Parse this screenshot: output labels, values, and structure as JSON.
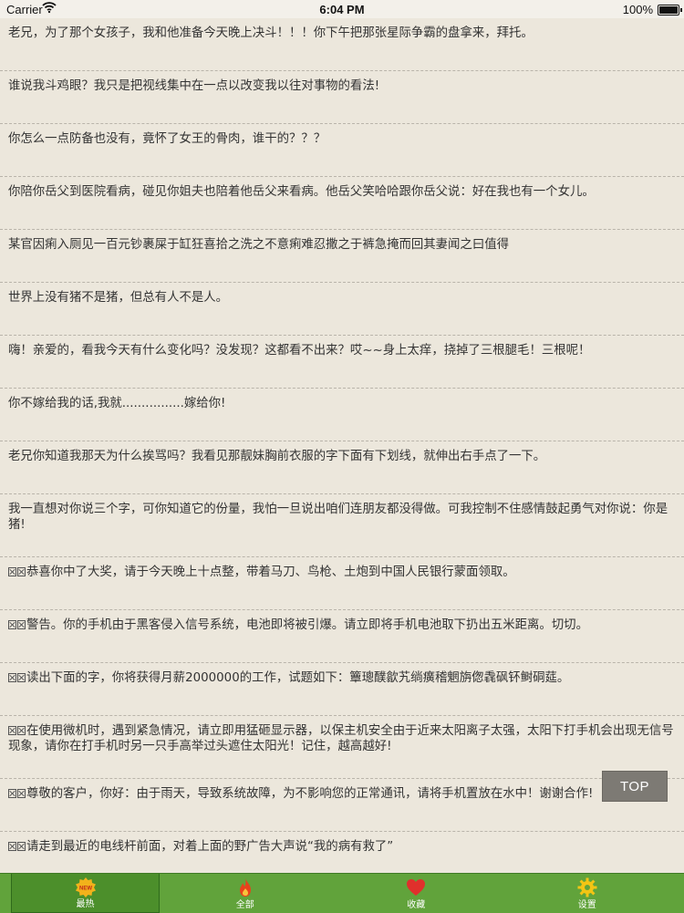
{
  "status_bar": {
    "carrier": "Carrier",
    "time": "6:04 PM",
    "battery": "100%"
  },
  "items": [
    "老兄，为了那个女孩子，我和他准备今天晚上决斗！！！你下午把那张星际争霸的盘拿来，拜托。",
    "谁说我斗鸡眼？我只是把视线集中在一点以改变我以往对事物的看法!",
    "你怎么一点防备也没有，竟怀了女王的骨肉，谁干的？？？",
    "你陪你岳父到医院看病，碰见你姐夫也陪着他岳父来看病。他岳父笑哈哈跟你岳父说：好在我也有一个女儿。",
    "某官因痢入厕见一百元钞裹屎于缸狂喜拾之洗之不意痢难忍撒之于裤急掩而回其妻闻之曰值得",
    "世界上没有猪不是猪，但总有人不是人。",
    "嗨！亲爱的，看我今天有什么变化吗？没发现？这都看不出来？哎~~身上太痒，挠掉了三根腿毛！三根呢！",
    "你不嫁给我的话,我就................嫁给你!",
    "老兄你知道我那天为什么挨骂吗？我看见那靓妹胸前衣服的字下面有下划线，就伸出右手点了一下。",
    "我一直想对你说三个字，可你知道它的份量，我怕一旦说出咱们连朋友都没得做。可我控制不住感情鼓起勇气对你说：你是猪!",
    "恭喜你中了大奖，请于今天晚上十点整，带着马刀、鸟枪、土炮到中国人民银行蒙面领取。",
    "警告。你的手机由于黑客侵入信号系统，电池即将被引爆。请立即将手机电池取下扔出五米距离。切切。",
    "读出下面的字，你将获得月薪2000000的工作，试题如下：簟璁醭歙艽绱癀稽魍旃偬毳砜钚鲥硐莚。",
    "在使用微机时，遇到紧急情况，请立即用猛砸显示器，以保主机安全由于近来太阳离子太强，太阳下打手机会出现无信号现象，请你在打手机时另一只手高举过头遮住太阳光！记住，越高越好!",
    "尊敬的客户，你好：由于雨天，导致系统故障，为不影响您的正常通讯，请将手机置放在水中！谢谢合作!",
    "请走到最近的电线杆前面，对着上面的野广告大声说“我的病有救了”"
  ],
  "top_button": "TOP",
  "tabs": [
    {
      "label": "最热",
      "icon": "new-badge-icon",
      "badge": "NEW"
    },
    {
      "label": "全部",
      "icon": "flame-icon"
    },
    {
      "label": "收藏",
      "icon": "heart-icon"
    },
    {
      "label": "设置",
      "icon": "gear-icon"
    }
  ],
  "colors": {
    "background": "#ece7dc",
    "tab_bar": "#61a33b",
    "tab_active": "#4c8f2b",
    "top_button": "#7d7a74"
  }
}
